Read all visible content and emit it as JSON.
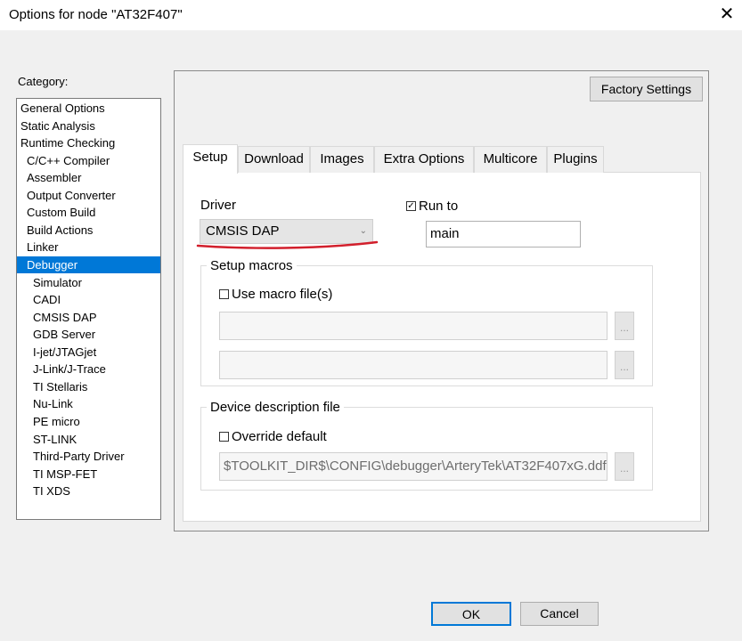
{
  "window": {
    "title": "Options for node \"AT32F407\"",
    "close_glyph": "✕"
  },
  "category": {
    "label": "Category:",
    "items": [
      "General Options",
      "Static Analysis",
      "Runtime Checking",
      "C/C++ Compiler",
      "Assembler",
      "Output Converter",
      "Custom Build",
      "Build Actions",
      "Linker",
      "Debugger",
      "Simulator",
      "CADI",
      "CMSIS DAP",
      "GDB Server",
      "I-jet/JTAGjet",
      "J-Link/J-Trace",
      "TI Stellaris",
      "Nu-Link",
      "PE micro",
      "ST-LINK",
      "Third-Party Driver",
      "TI MSP-FET",
      "TI XDS"
    ],
    "selected": "Debugger"
  },
  "buttons": {
    "factory": "Factory Settings",
    "ok": "OK",
    "cancel": "Cancel"
  },
  "tabs": [
    "Setup",
    "Download",
    "Images",
    "Extra Options",
    "Multicore",
    "Plugins"
  ],
  "active_tab": "Setup",
  "setup": {
    "driver_label": "Driver",
    "driver_value": "CMSIS DAP",
    "run_to_label": "Run to",
    "run_to_checked": true,
    "run_to_value": "main",
    "macros_title": "Setup macros",
    "use_macro_label": "Use macro file(s)",
    "use_macro_checked": false,
    "macro_file_1": "",
    "macro_file_2": "",
    "device_title": "Device description file",
    "override_label": "Override default",
    "override_checked": false,
    "device_file": "$TOOLKIT_DIR$\\CONFIG\\debugger\\ArteryTek\\AT32F407xG.ddf",
    "browse_glyph": "..."
  },
  "colors": {
    "selection": "#0078d7",
    "annotation": "#d21f2c"
  }
}
